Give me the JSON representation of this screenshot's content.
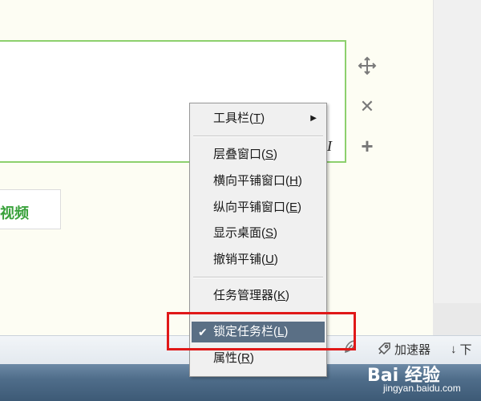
{
  "page": {
    "video_label": "视频",
    "italic_label": "I"
  },
  "side_icons": [
    "move-icon",
    "close-icon",
    "plus-icon"
  ],
  "context_menu": {
    "items": [
      {
        "label": "工具栏(",
        "key": "T",
        "suffix": ")",
        "submenu": true
      },
      {
        "label": "层叠窗口(",
        "key": "S",
        "suffix": ")"
      },
      {
        "label": "横向平铺窗口(",
        "key": "H",
        "suffix": ")"
      },
      {
        "label": "纵向平铺窗口(",
        "key": "E",
        "suffix": ")"
      },
      {
        "label": "显示桌面(",
        "key": "S",
        "suffix": ")"
      },
      {
        "label": "撤销平铺(",
        "key": "U",
        "suffix": ")"
      },
      {
        "label": "任务管理器(",
        "key": "K",
        "suffix": ")"
      },
      {
        "label": "锁定任务栏(",
        "key": "L",
        "suffix": ")",
        "checked": true,
        "highlighted": true
      },
      {
        "label": "属性(",
        "key": "R",
        "suffix": ")"
      }
    ],
    "check_mark": "✔",
    "submenu_arrow": "▶"
  },
  "status_bar": {
    "speedup_label": "加速器",
    "download_label": "下"
  },
  "watermark": {
    "brand": "Bai 经验",
    "url": "jingyan.baidu.com"
  },
  "colors": {
    "highlight": "#5a6f85",
    "frame": "#e01818",
    "green_border": "#8dd06d",
    "video_text": "#38a13a"
  }
}
